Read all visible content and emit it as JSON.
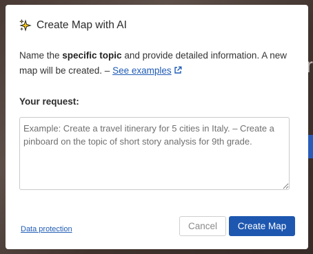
{
  "dialog": {
    "title": "Create Map with AI",
    "title_icon": "sparkles-icon",
    "description_prefix": "Name the ",
    "description_bold": "specific topic",
    "description_suffix": " and provide detailed information. A new map will be created. – ",
    "see_examples_label": "See examples",
    "request_label": "Your request:",
    "request_value": "",
    "request_placeholder": "Example: Create a travel itinerary for 5 cities in Italy. – Create a pinboard on the topic of short story analysis for 9th grade.",
    "data_protection_label": "Data protection",
    "cancel_label": "Cancel",
    "create_label": "Create Map"
  },
  "colors": {
    "accent": "#1d57b0",
    "link": "#1f5bb5",
    "sparkle_fill": "#f5c518"
  }
}
